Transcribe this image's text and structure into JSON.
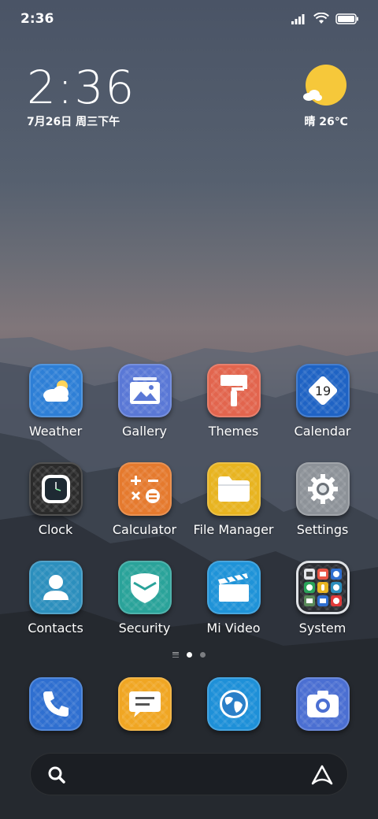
{
  "status_bar": {
    "time": "2:36",
    "icons": [
      "signal-icon",
      "wifi-icon",
      "battery-icon"
    ]
  },
  "clock_widget": {
    "time": "2:36",
    "date": "7月26日 周三下午"
  },
  "weather_widget": {
    "condition_icon": "sunny-icon",
    "text": "晴 26℃"
  },
  "apps": [
    {
      "label": "Weather",
      "icon": "weather-icon",
      "color": "#2e7fd6"
    },
    {
      "label": "Gallery",
      "icon": "gallery-icon",
      "color": "#5a78d6"
    },
    {
      "label": "Themes",
      "icon": "themes-icon",
      "color": "#e2654e"
    },
    {
      "label": "Calendar",
      "icon": "calendar-icon",
      "color": "#1f63c4",
      "badge": "19"
    },
    {
      "label": "Clock",
      "icon": "clock-icon",
      "color": "#2b2b2b"
    },
    {
      "label": "Calculator",
      "icon": "calculator-icon",
      "color": "#e57a2e"
    },
    {
      "label": "File Manager",
      "icon": "file-manager-icon",
      "color": "#e8b420"
    },
    {
      "label": "Settings",
      "icon": "settings-icon",
      "color": "#8d9298"
    },
    {
      "label": "Contacts",
      "icon": "contacts-icon",
      "color": "#2c8fbd"
    },
    {
      "label": "Security",
      "icon": "security-icon",
      "color": "#2aa39a"
    },
    {
      "label": "Mi Video",
      "icon": "video-icon",
      "color": "#1f93d8"
    },
    {
      "label": "System",
      "icon": "system-folder-icon",
      "color": "#2a2c31"
    }
  ],
  "dock": [
    {
      "name": "phone",
      "icon": "phone-icon",
      "color": "#2f6fd0"
    },
    {
      "name": "messages",
      "icon": "messages-icon",
      "color": "#f0a623"
    },
    {
      "name": "browser",
      "icon": "browser-icon",
      "color": "#1e90d8"
    },
    {
      "name": "camera",
      "icon": "camera-icon",
      "color": "#4b6fd2"
    }
  ],
  "search_bar": {
    "search_icon": "search-icon",
    "assistant_icon": "assistant-icon"
  }
}
